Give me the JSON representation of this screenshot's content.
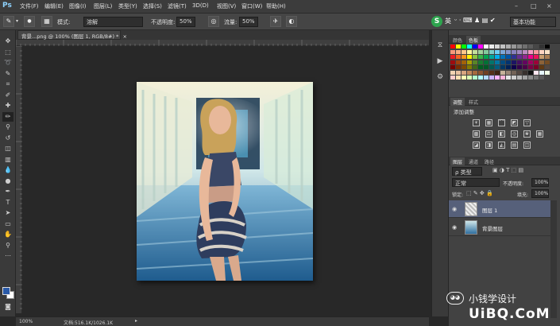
{
  "app": {
    "logo": "Ps"
  },
  "menubar": {
    "items": [
      "文件(F)",
      "编辑(E)",
      "图像(I)",
      "图层(L)",
      "类型(Y)",
      "选择(S)",
      "滤镜(T)",
      "3D(D)",
      "视图(V)",
      "窗口(W)",
      "帮助(H)"
    ],
    "window_controls": [
      "–",
      "□",
      "×"
    ]
  },
  "options": {
    "mode_label": "模式:",
    "mode_value": "溶解",
    "opacity_label": "不透明度:",
    "opacity_value": "50%",
    "flow_label": "流量:",
    "flow_value": "50%",
    "ime_badge": "S",
    "ime_lang": "英",
    "workspace": "基本功能"
  },
  "document": {
    "tab_title": "背景...png @ 100% (图层 1, RGB/8#) *",
    "tab_close": "×"
  },
  "status": {
    "zoom": "100%",
    "doc_info": "文档:516.1K/1026.1K"
  },
  "panels": {
    "swatch_tabs": [
      "颜色",
      "色板"
    ],
    "adjust_tabs": [
      "调整",
      "样式"
    ],
    "adjust_title": "添加调整",
    "layer_tabs": [
      "图层",
      "通道",
      "路径"
    ],
    "filter_kind": "ρ 类型",
    "blend_mode": "正常",
    "opacity_label": "不透明度:",
    "opacity_value": "100%",
    "lock_label": "锁定:",
    "fill_label": "填充:",
    "fill_value": "100%",
    "layers": [
      {
        "name": "图层 1",
        "selected": true
      },
      {
        "name": "背景图层",
        "selected": false
      }
    ]
  },
  "watermark": {
    "text": "小钱学设计",
    "site": "UiBQ.CoM"
  },
  "colors": {
    "accent": "#8fd3ff",
    "panel": "#424242",
    "selected_layer": "#56607a"
  }
}
